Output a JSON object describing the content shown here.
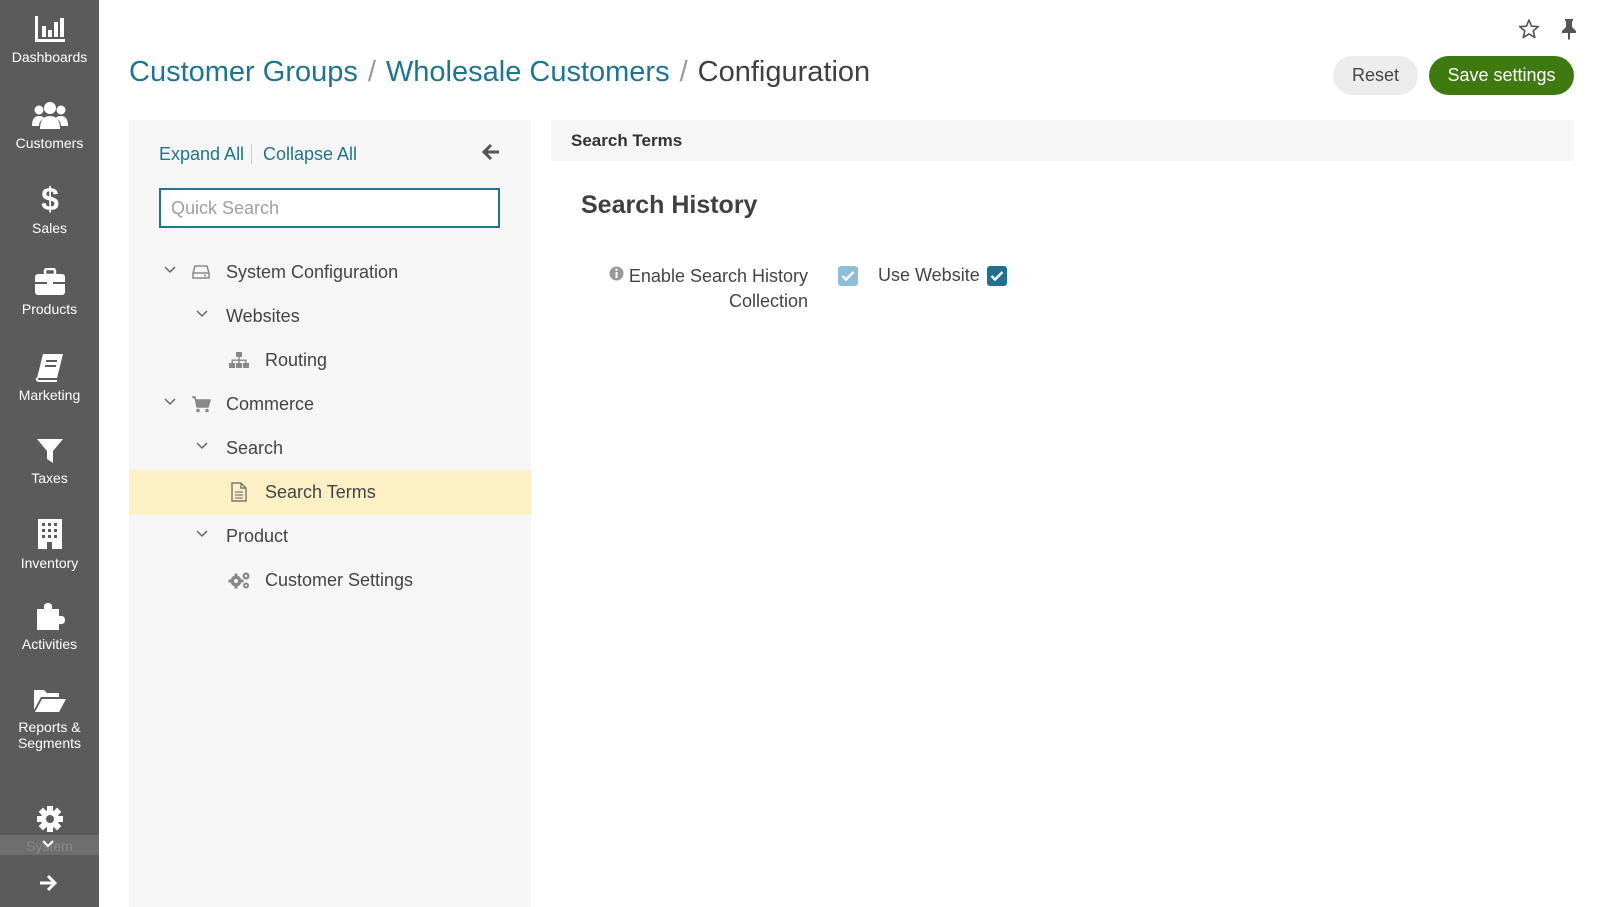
{
  "nav": {
    "items": [
      {
        "label": "Dashboards",
        "icon": "bar-chart-icon"
      },
      {
        "label": "Customers",
        "icon": "users-icon"
      },
      {
        "label": "Sales",
        "icon": "dollar-icon"
      },
      {
        "label": "Products",
        "icon": "briefcase-icon"
      },
      {
        "label": "Marketing",
        "icon": "book-icon"
      },
      {
        "label": "Taxes",
        "icon": "filter-icon"
      },
      {
        "label": "Inventory",
        "icon": "building-icon"
      },
      {
        "label": "Activities",
        "icon": "puzzle-icon"
      },
      {
        "label": "Reports &",
        "label2": "Segments",
        "icon": "folder-open-icon"
      },
      {
        "label": "System",
        "icon": "gear-icon"
      }
    ]
  },
  "breadcrumb": {
    "items": [
      "Customer Groups",
      "Wholesale Customers"
    ],
    "separator": "/",
    "current": "Configuration"
  },
  "actions": {
    "reset_label": "Reset",
    "save_label": "Save settings"
  },
  "tree": {
    "expand_all": "Expand All",
    "collapse_all": "Collapse All",
    "search_placeholder": "Quick Search",
    "nodes": [
      {
        "label": "System Configuration",
        "icon": "server-icon",
        "expanded": true
      },
      {
        "label": "Websites",
        "expanded": true
      },
      {
        "label": "Routing",
        "icon": "sitemap-icon"
      },
      {
        "label": "Commerce",
        "icon": "cart-icon",
        "expanded": true
      },
      {
        "label": "Search",
        "expanded": true
      },
      {
        "label": "Search Terms",
        "icon": "document-icon",
        "selected": true
      },
      {
        "label": "Product",
        "expanded": true
      },
      {
        "label": "Customer Settings",
        "icon": "gears-icon"
      }
    ]
  },
  "content": {
    "section_title": "Search Terms",
    "group_title": "Search History",
    "fields": [
      {
        "label_line1": "Enable Search History",
        "label_line2": "Collection",
        "checked": true,
        "use_website_label": "Use Website",
        "use_website_checked": true
      }
    ]
  },
  "colors": {
    "nav_bg": "#5b5b5b",
    "link": "#1e7592",
    "save_button": "#3f7a11",
    "selected_row": "#fdf0c4",
    "panel_bg": "#f6f6f6"
  }
}
